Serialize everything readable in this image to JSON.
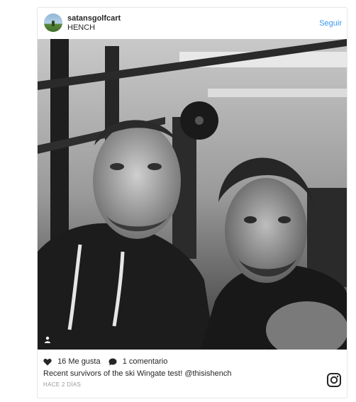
{
  "post": {
    "username": "satansgolfcart",
    "sublabel": "HENCH",
    "follow_label": "Seguir",
    "likes": "16 Me gusta",
    "comments": "1 comentario",
    "caption_text": "Recent survivors of the ski Wingate test! ",
    "caption_mention": "@thisishench",
    "timestamp": "HACE 2 DÍAS"
  },
  "icons": {
    "avatar": "avatar-landscape",
    "tag": "user-tag-icon",
    "like": "heart-icon",
    "comment": "comment-icon",
    "brand": "instagram-icon"
  },
  "colors": {
    "accent": "#3897f0",
    "text": "#262626",
    "muted": "#999999",
    "border": "#e6e6e6"
  }
}
